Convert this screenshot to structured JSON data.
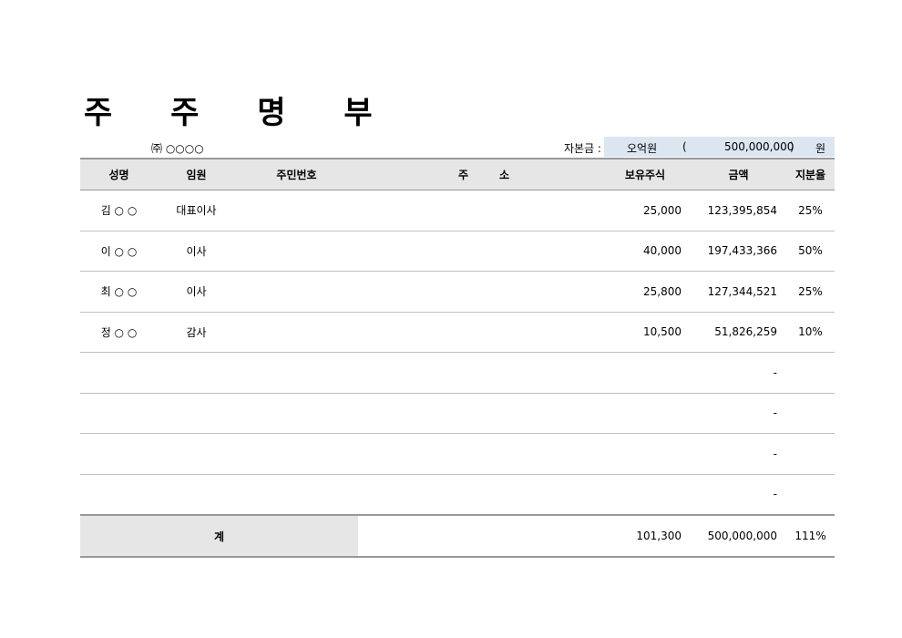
{
  "title": "주 주 명 부",
  "company": "㈜ ○○○○",
  "capital": {
    "label": "자본금 :",
    "korean": "오억원",
    "open_paren": "(",
    "amount": "500,000,000",
    "close_paren": ")",
    "unit": "원"
  },
  "table": {
    "headers": {
      "name": "성명",
      "role": "임원",
      "id": "주민번호",
      "addr1": "주",
      "addr2": "소",
      "shares": "보유주식",
      "amount": "금액",
      "ratio": "지분율"
    },
    "rows": [
      {
        "name": "김 ○ ○",
        "role": "대표이사",
        "shares": "25,000",
        "amount": "123,395,854",
        "ratio": "25%"
      },
      {
        "name": "이 ○ ○",
        "role": "이사",
        "shares": "40,000",
        "amount": "197,433,366",
        "ratio": "50%"
      },
      {
        "name": "최 ○ ○",
        "role": "이사",
        "shares": "25,800",
        "amount": "127,344,521",
        "ratio": "25%"
      },
      {
        "name": "정 ○ ○",
        "role": "감사",
        "shares": "10,500",
        "amount": "51,826,259",
        "ratio": "10%"
      },
      {
        "name": "",
        "role": "",
        "shares": "",
        "amount": "-",
        "ratio": ""
      },
      {
        "name": "",
        "role": "",
        "shares": "",
        "amount": "-",
        "ratio": ""
      },
      {
        "name": "",
        "role": "",
        "shares": "",
        "amount": "-",
        "ratio": ""
      },
      {
        "name": "",
        "role": "",
        "shares": "",
        "amount": "-",
        "ratio": ""
      }
    ],
    "total": {
      "label": "계",
      "shares": "101,300",
      "amount": "500,000,000",
      "ratio": "111%"
    }
  }
}
